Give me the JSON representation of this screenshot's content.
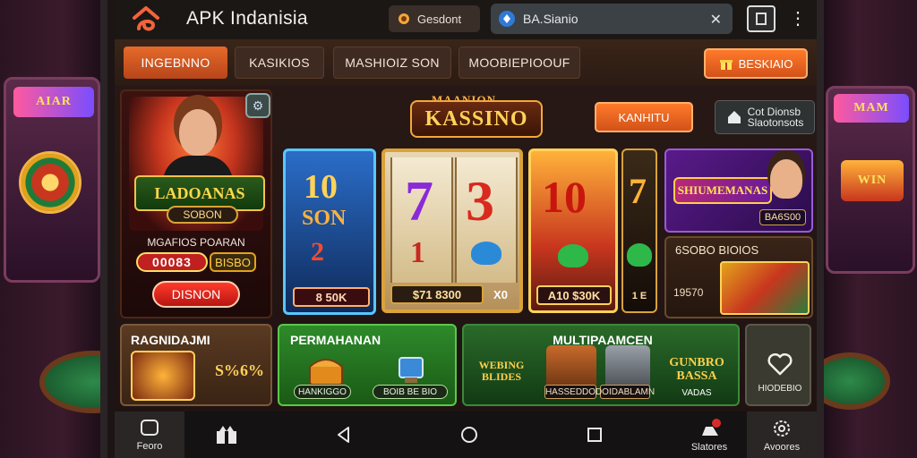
{
  "topbar": {
    "app_title": "APK Indanisia",
    "search_button": "Gesdont",
    "tab_text": "BA.Sianio",
    "tab_close": "✕",
    "menu_dots": "⋮"
  },
  "nav": {
    "tabs": [
      {
        "label": "INGEBNNO"
      },
      {
        "label": "KASIKIOS"
      },
      {
        "label": "MASHIOIZ SON"
      },
      {
        "label": "MOOBIEPIOOUF"
      }
    ],
    "action_button": "BESKIAIO"
  },
  "promo": {
    "badge": "LADOANAS",
    "sub_badge": "SOBON",
    "label": "MGAFIOS POARAN",
    "counter": "00083",
    "amount": "BISBO",
    "button": "DISNON"
  },
  "center": {
    "kassino_sub": "MAANION",
    "kassino": "KASSINO",
    "kanhitu_button": "KANHITU",
    "settings_button_line1": "Cot Dionsb",
    "settings_button_line2": "Slaotonsots"
  },
  "reels": {
    "blue_top": "10",
    "blue_mid": "SON",
    "blue_low": "2",
    "blue_caption": "8 50K",
    "main_left_top": "7",
    "main_left_low": "1",
    "main_right_top": "3",
    "main_caption": "$71 8300",
    "main_caption_suffix": "X0",
    "gold_top": "10",
    "gold_caption": "A10 $30K",
    "dark_top": "7",
    "dark_caption": "1 E"
  },
  "right_cards": {
    "purple_badge": "SHIUMEMANAS",
    "purple_tag": "BA6S00",
    "brown_title": "6SOBO BIOIOS",
    "brown_num": "19570"
  },
  "bottom_cards": {
    "c1_title": "RAGNIDAJMI",
    "c1_pct": "S%6%",
    "c2_title": "PERMAHANAN",
    "c2_pill1": "HANKIGGO",
    "c2_pill2": "BOIB BE BIO",
    "c3_title": "MULTIPAAMCEN",
    "c3_left": "WEBING BLIDES",
    "c3_pill1": "HASSEDDO",
    "c3_pill2": "DOIDABLAMN",
    "c3_right": "GUNBRO BASSA",
    "c3_right_sub": "VADAS",
    "c4_label": "HIODEBIO"
  },
  "bottomnav": {
    "home": "Feoro",
    "settings": "Slatores",
    "more": "Avoores"
  },
  "colors": {
    "accent_orange": "#e56a2a",
    "gold": "#ffd25a",
    "green": "#2e8a2a"
  },
  "icons": [
    "home-icon",
    "gift-icon",
    "back-icon",
    "circle-home-icon",
    "recents-icon",
    "bell-icon",
    "gear-icon",
    "heart-icon",
    "search-icon",
    "tabs-icon",
    "menu-icon"
  ]
}
